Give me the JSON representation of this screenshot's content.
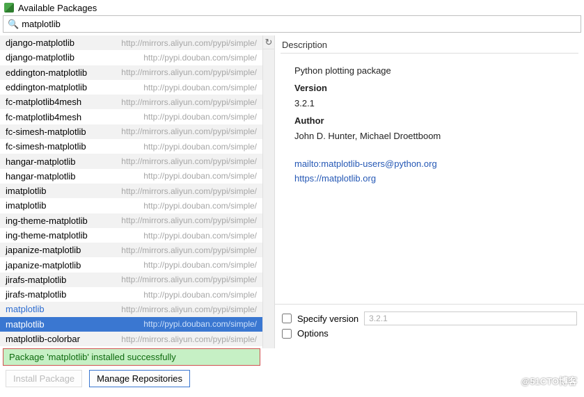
{
  "window_title": "Available Packages",
  "search_value": "matplotlib",
  "packages": [
    {
      "name": "django-matplotlib",
      "url": "http://mirrors.aliyun.com/pypi/simple/"
    },
    {
      "name": "django-matplotlib",
      "url": "http://pypi.douban.com/simple/"
    },
    {
      "name": "eddington-matplotlib",
      "url": "http://mirrors.aliyun.com/pypi/simple/"
    },
    {
      "name": "eddington-matplotlib",
      "url": "http://pypi.douban.com/simple/"
    },
    {
      "name": "fc-matplotlib4mesh",
      "url": "http://mirrors.aliyun.com/pypi/simple/"
    },
    {
      "name": "fc-matplotlib4mesh",
      "url": "http://pypi.douban.com/simple/"
    },
    {
      "name": "fc-simesh-matplotlib",
      "url": "http://mirrors.aliyun.com/pypi/simple/"
    },
    {
      "name": "fc-simesh-matplotlib",
      "url": "http://pypi.douban.com/simple/"
    },
    {
      "name": "hangar-matplotlib",
      "url": "http://mirrors.aliyun.com/pypi/simple/"
    },
    {
      "name": "hangar-matplotlib",
      "url": "http://pypi.douban.com/simple/"
    },
    {
      "name": "imatplotlib",
      "url": "http://mirrors.aliyun.com/pypi/simple/"
    },
    {
      "name": "imatplotlib",
      "url": "http://pypi.douban.com/simple/"
    },
    {
      "name": "ing-theme-matplotlib",
      "url": "http://mirrors.aliyun.com/pypi/simple/"
    },
    {
      "name": "ing-theme-matplotlib",
      "url": "http://pypi.douban.com/simple/"
    },
    {
      "name": "japanize-matplotlib",
      "url": "http://mirrors.aliyun.com/pypi/simple/"
    },
    {
      "name": "japanize-matplotlib",
      "url": "http://pypi.douban.com/simple/"
    },
    {
      "name": "jirafs-matplotlib",
      "url": "http://mirrors.aliyun.com/pypi/simple/"
    },
    {
      "name": "jirafs-matplotlib",
      "url": "http://pypi.douban.com/simple/"
    },
    {
      "name": "matplotlib",
      "url": "http://mirrors.aliyun.com/pypi/simple/",
      "highlighted": true
    },
    {
      "name": "matplotlib",
      "url": "http://pypi.douban.com/simple/",
      "selected": true
    },
    {
      "name": "matplotlib-colorbar",
      "url": "http://mirrors.aliyun.com/pypi/simple/"
    }
  ],
  "details": {
    "header": "Description",
    "summary": "Python plotting package",
    "version_label": "Version",
    "version_value": "3.2.1",
    "author_label": "Author",
    "author_value": "John D. Hunter, Michael Droettboom",
    "link1": "mailto:matplotlib-users@python.org",
    "link2": "https://matplotlib.org"
  },
  "specify_version_label": "Specify version",
  "specify_version_value": "3.2.1",
  "options_label": "Options",
  "status_message": "Package 'matplotlib' installed successfully",
  "install_button": "Install Package",
  "manage_button": "Manage Repositories",
  "watermark": "@51CTO博客"
}
